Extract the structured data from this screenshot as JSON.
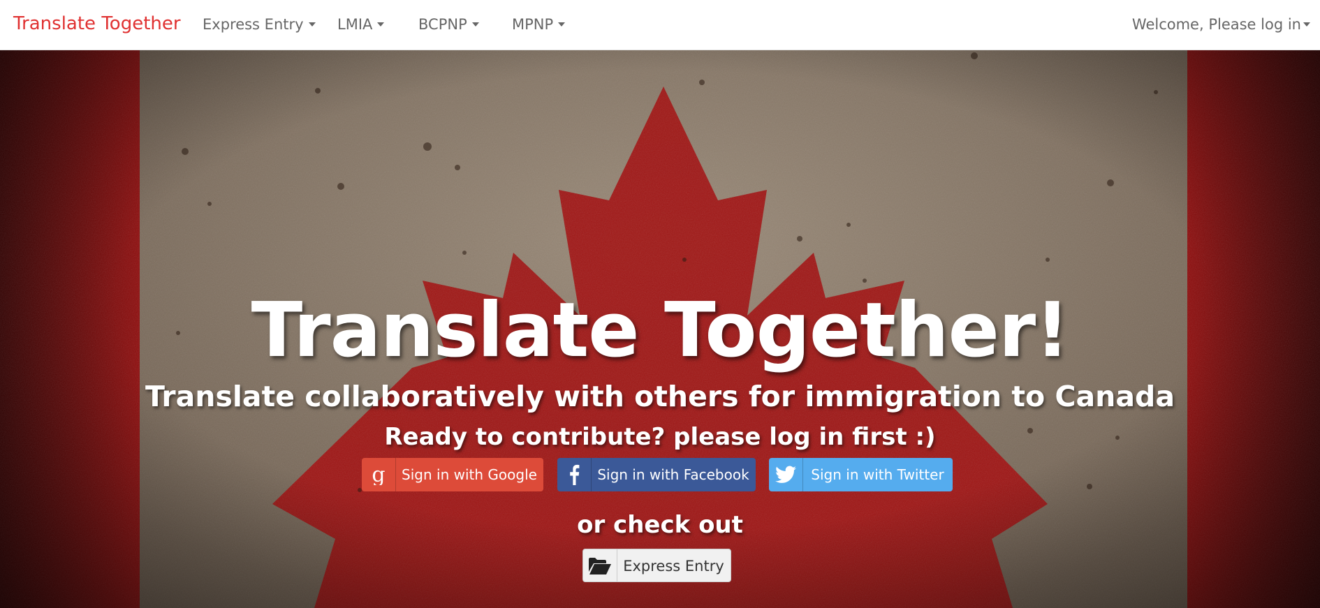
{
  "navbar": {
    "brand": "Translate Together",
    "menus": [
      {
        "label": "Express Entry"
      },
      {
        "label": "LMIA"
      },
      {
        "label": "BCPNP"
      },
      {
        "label": "MPNP"
      }
    ],
    "user_menu": "Welcome, Please log in"
  },
  "hero": {
    "title": "Translate Together!",
    "subtitle": "Translate collaboratively with others for immigration to Canada",
    "prompt": "Ready to contribute? please log in first :)",
    "sign_in": {
      "google": "Sign in with Google",
      "facebook": "Sign in with Facebook",
      "twitter": "Sign in with Twitter"
    },
    "or_text": "or check out",
    "express_entry": "Express Entry"
  },
  "icons": {
    "google": "google-icon",
    "facebook": "facebook-icon",
    "twitter": "twitter-icon",
    "folder": "folder-open-icon",
    "caret": "caret-down-icon",
    "maple_leaf": "maple-leaf-icon"
  },
  "colors": {
    "brand": "#e03131",
    "google": "#dd4b39",
    "facebook": "#3b5998",
    "twitter": "#55acee",
    "flag_red": "#8f0b0b",
    "flag_center": "#8a7a6a"
  }
}
